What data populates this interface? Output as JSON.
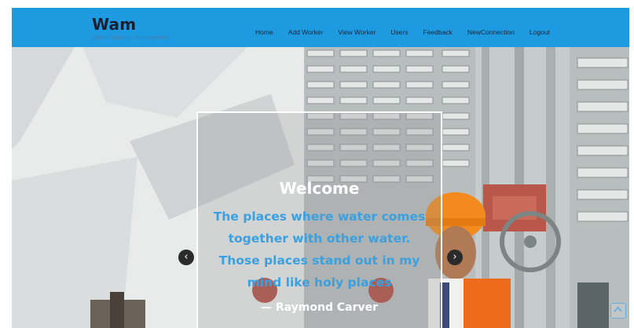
{
  "header": {
    "brand_name": "Wam",
    "brand_subtitle": "Water Authority Management",
    "nav_items": [
      "Home",
      "Add Worker",
      "View Worker",
      "Users",
      "Feedback",
      "NewConnection",
      "Logout"
    ]
  },
  "hero": {
    "title": "Welcome",
    "quote_lines": [
      "The places where water comes",
      "together with other water.",
      "Those places stand out in my",
      "mind like holy places"
    ],
    "author": "— Raymond Carver",
    "prev_icon": "chevron-left-icon",
    "next_icon": "chevron-right-icon"
  },
  "colors": {
    "navbar": "#1e9be0",
    "brand": "#172033",
    "quote": "#3aa0e0"
  }
}
